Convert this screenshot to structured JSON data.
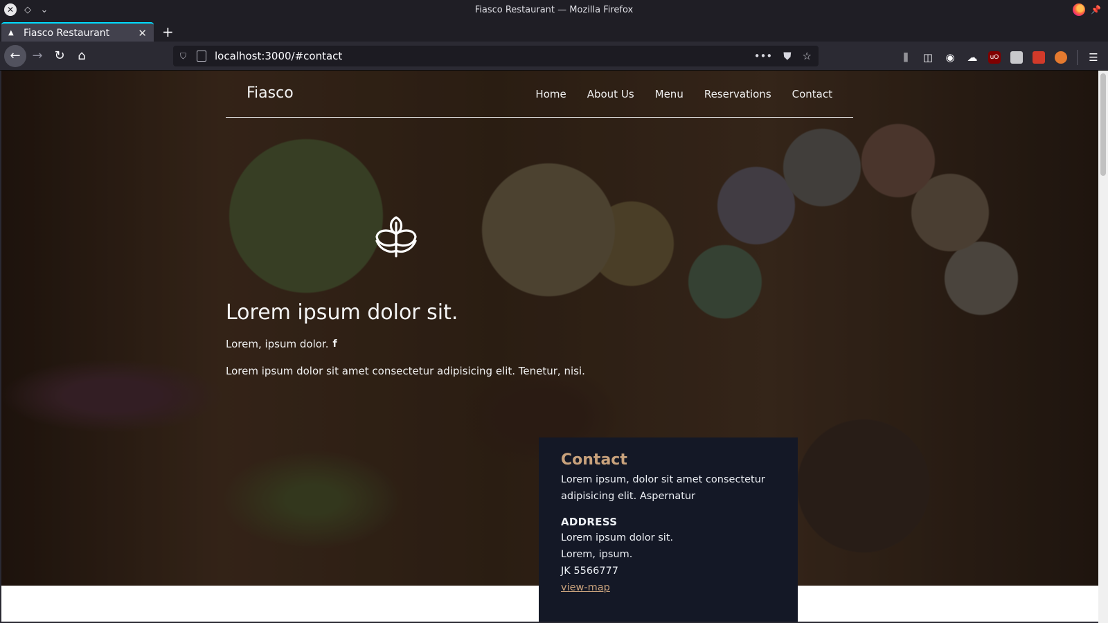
{
  "browser": {
    "window_title": "Fiasco Restaurant — Mozilla Firefox",
    "tab_label": "Fiasco Restaurant",
    "url": "localhost:3000/#contact",
    "new_tab_glyph": "+",
    "tab_close_glyph": "✕"
  },
  "site": {
    "brand": "Fiasco",
    "nav": [
      "Home",
      "About Us",
      "Menu",
      "Reservations",
      "Contact"
    ]
  },
  "hero": {
    "title": "Lorem ipsum dolor sit.",
    "subtitle": "Lorem, ipsum dolor.",
    "facebook_glyph": "f",
    "text": "Lorem ipsum dolor sit amet consectetur adipisicing elit. Tenetur, nisi."
  },
  "contact": {
    "heading": "Contact",
    "intro_line1": "Lorem ipsum, dolor sit amet consectetur",
    "intro_line2": "adipisicing elit. Aspernatur",
    "address_heading": "ADDRESS",
    "address_line1": "Lorem ipsum dolor sit.",
    "address_line2": "Lorem, ipsum.",
    "address_line3": "JK 5566777",
    "map_link": "view-map"
  },
  "colors": {
    "accent": "#c9a27c",
    "card_bg": "#141826",
    "tab_highlight": "#00ddff"
  }
}
